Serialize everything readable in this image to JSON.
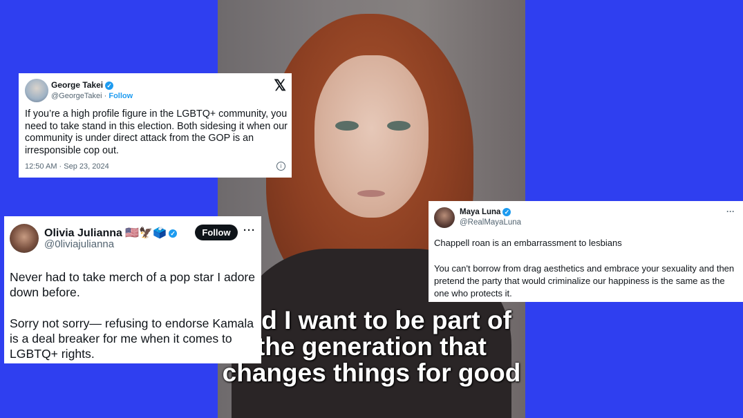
{
  "caption": {
    "line1": "and I want to be part of",
    "line2": "the generation that",
    "line3": "changes things for good"
  },
  "tweet1": {
    "name": "George Takei",
    "handle": "@GeorgeTakei",
    "separator": "·",
    "follow": "Follow",
    "text": "If you’re a high profile figure in the LGBTQ+ community, you need to take stand in this election. Both sidesing it when our community is under direct attack from the GOP is an irresponsible cop out.",
    "timestamp": "12:50 AM · Sep 23, 2024",
    "logo_icon": "x-logo-icon",
    "info_icon": "info-icon"
  },
  "tweet2": {
    "name": "Olivia Julianna",
    "name_emoji": "🇺🇸🦅🗳️",
    "handle": "@0liviajulianna",
    "follow": "Follow",
    "more": "···",
    "paragraph1": "Never had to take merch of a pop star I adore down before.",
    "paragraph2": "Sorry not sorry— refusing to endorse Kamala is a deal breaker for me when it comes to LGBTQ+ rights."
  },
  "tweet3": {
    "name": "Maya Luna",
    "handle": "@RealMayaLuna",
    "more": "···",
    "paragraph1": "Chappell roan is an embarrassment to lesbians",
    "paragraph2": "You can't borrow from drag aesthetics and embrace your sexuality and then pretend the party that would criminalize our happiness is the same as the one who protects it."
  },
  "colors": {
    "background": "#2f3ff0",
    "verified": "#1d9bf0"
  }
}
